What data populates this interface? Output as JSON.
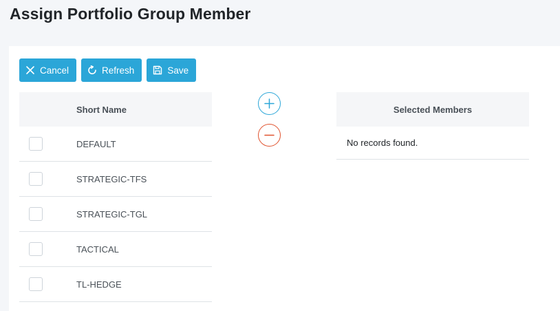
{
  "page": {
    "title": "Assign Portfolio Group Member"
  },
  "toolbar": {
    "cancel_label": "Cancel",
    "refresh_label": "Refresh",
    "save_label": "Save"
  },
  "available_table": {
    "header": "Short Name",
    "rows": [
      {
        "short_name": "DEFAULT",
        "checked": false
      },
      {
        "short_name": "STRATEGIC-TFS",
        "checked": false
      },
      {
        "short_name": "STRATEGIC-TGL",
        "checked": false
      },
      {
        "short_name": "TACTICAL",
        "checked": false
      },
      {
        "short_name": "TL-HEDGE",
        "checked": false
      }
    ]
  },
  "selected_table": {
    "header": "Selected Members",
    "empty_message": "No records found."
  },
  "colors": {
    "primary": "#2ba6d8",
    "danger": "#e0532f",
    "page_background": "#f4f6f9",
    "header_background": "#f5f6f8"
  },
  "icons": {
    "cancel": "close-icon",
    "refresh": "refresh-icon",
    "save": "save-icon",
    "add": "plus-circle-icon",
    "remove": "minus-circle-icon"
  }
}
